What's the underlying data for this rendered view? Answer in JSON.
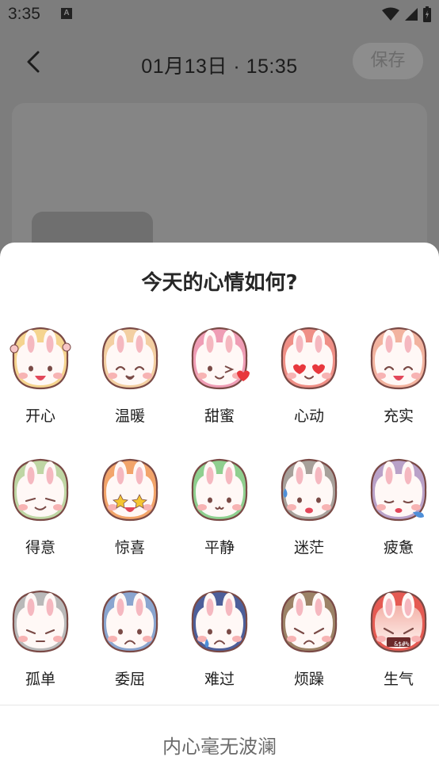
{
  "status_bar": {
    "time": "3:35",
    "notif": "A"
  },
  "header": {
    "title": "01月13日 · 15:35",
    "save_label": "保存"
  },
  "sheet": {
    "title": "今天的心情如何?",
    "calm_label": "内心毫无波澜",
    "moods": [
      {
        "label": "开心",
        "ear": "#f5d48f",
        "face": "happy"
      },
      {
        "label": "温暖",
        "ear": "#f3cfa2",
        "face": "warm"
      },
      {
        "label": "甜蜜",
        "ear": "#ef9db5",
        "face": "sweet"
      },
      {
        "label": "心动",
        "ear": "#ef8f86",
        "face": "love"
      },
      {
        "label": "充实",
        "ear": "#f2b39f",
        "face": "full"
      },
      {
        "label": "得意",
        "ear": "#bfd6a4",
        "face": "smug"
      },
      {
        "label": "惊喜",
        "ear": "#f2a46a",
        "face": "surprise"
      },
      {
        "label": "平静",
        "ear": "#8fcf8f",
        "face": "calm"
      },
      {
        "label": "迷茫",
        "ear": "#a7a09a",
        "face": "confused"
      },
      {
        "label": "疲惫",
        "ear": "#b9a1c8",
        "face": "tired"
      },
      {
        "label": "孤单",
        "ear": "#b9b9b9",
        "face": "lonely"
      },
      {
        "label": "委屈",
        "ear": "#8aa5cf",
        "face": "wronged"
      },
      {
        "label": "难过",
        "ear": "#4d5f9a",
        "face": "sad"
      },
      {
        "label": "烦躁",
        "ear": "#9c8266",
        "face": "irritated"
      },
      {
        "label": "生气",
        "ear": "#e55a52",
        "face": "angry",
        "badge": "&$#%"
      }
    ]
  },
  "colors": {
    "outline": "#7a4a46",
    "cheek": "#f7b3b3",
    "inner_ear": "#f5b8c0"
  }
}
